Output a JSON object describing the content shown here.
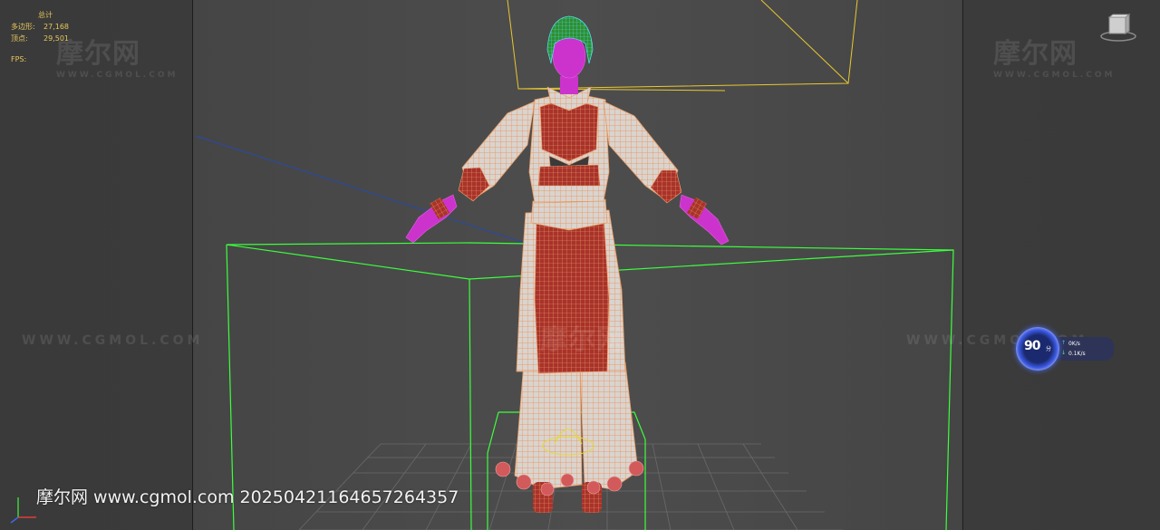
{
  "stats": {
    "title": "总计",
    "polygons_label": "多边形:",
    "polygons_value": "27,168",
    "vertices_label": "顶点:",
    "vertices_value": "29,501",
    "fps_label": "FPS:"
  },
  "watermarks": {
    "logo_text": "摩尔网",
    "url_small": "WWW.CGMOL.COM",
    "url_line": "WWW.CGMOL.COM"
  },
  "footer": {
    "text": "摩尔网 www.cgmol.com 20250421164657264357"
  },
  "network_widget": {
    "score": "90",
    "unit": "分",
    "upload": "0K/s",
    "download": "0.1K/s"
  },
  "colors": {
    "stats_text": "#e6c85c",
    "bounding_box": "#3cff3c",
    "camera_frustum": "#e8c832",
    "wire_cloth": "#f0a878",
    "skin": "#cc33cc",
    "hair": "#33aa33"
  }
}
